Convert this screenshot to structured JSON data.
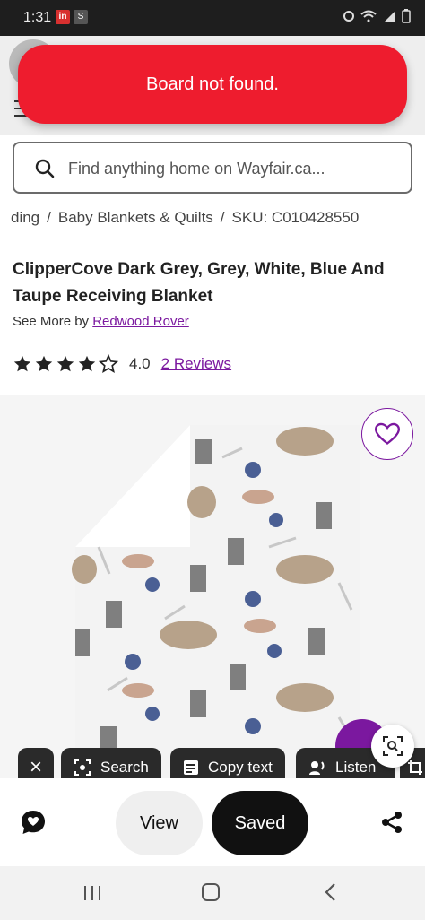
{
  "status_bar": {
    "time": "1:31",
    "badge1": "in",
    "badge2": "S"
  },
  "toast": {
    "message": "Board not found."
  },
  "search": {
    "placeholder": "Find anything home on Wayfair.ca..."
  },
  "breadcrumb": {
    "items": [
      "ding",
      "Baby Blankets & Quilts",
      "SKU: C010428550"
    ]
  },
  "product": {
    "title": "ClipperCove Dark Grey, Grey, White, Blue And Taupe Receiving Blanket",
    "see_more_prefix": "See More by",
    "brand": "Redwood Rover",
    "rating": "4.0",
    "rating_stars": 4,
    "reviews_label": "2 Reviews"
  },
  "lens": {
    "close_label": "×",
    "search_label": "Search",
    "copy_text_label": "Copy text",
    "listen_label": "Listen"
  },
  "actions": {
    "view_label": "View",
    "saved_label": "Saved"
  },
  "colors": {
    "toast_bg": "#ee1c2e",
    "link_purple": "#7b189f",
    "saved_bg": "#111111"
  },
  "icons": [
    "search-icon",
    "heart-icon",
    "star-icon",
    "chat-icon",
    "share-icon",
    "lens-icon",
    "copy-icon",
    "listen-icon",
    "close-icon",
    "recent-apps-icon",
    "home-icon",
    "back-icon"
  ]
}
